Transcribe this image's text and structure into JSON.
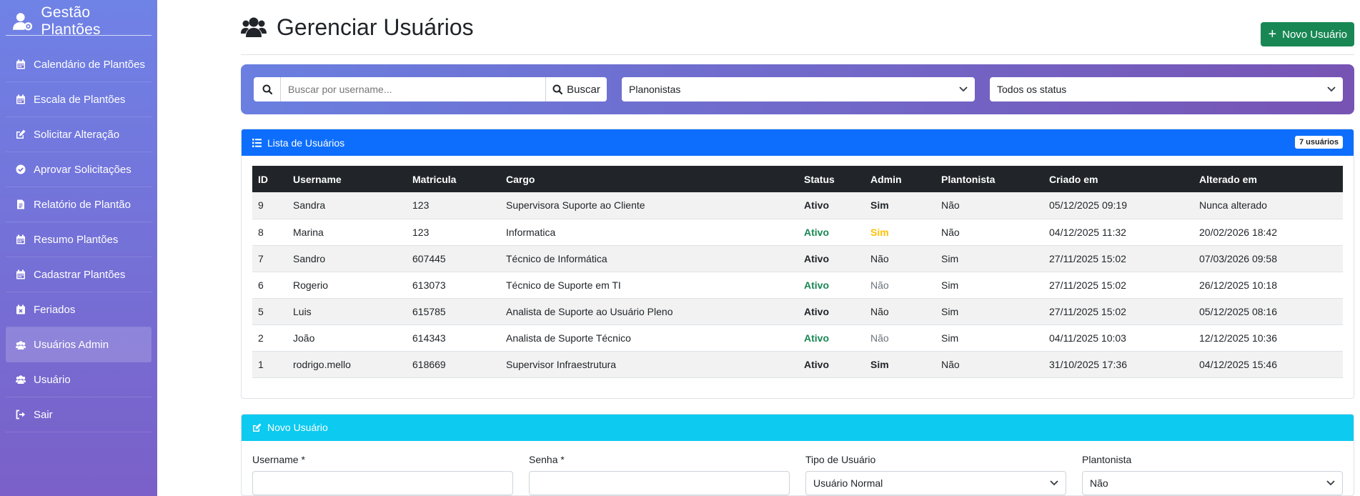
{
  "app": {
    "title": "Gestão Plantões"
  },
  "sidebar": {
    "items": [
      {
        "label": "Calendário de Plantões",
        "icon": "calendar-icon"
      },
      {
        "label": "Escala de Plantões",
        "icon": "calendar-icon"
      },
      {
        "label": "Solicitar Alteração",
        "icon": "edit-icon"
      },
      {
        "label": "Aprovar Solicitações",
        "icon": "check-circle-icon"
      },
      {
        "label": "Relatório de Plantão",
        "icon": "file-icon"
      },
      {
        "label": "Resumo Plantões",
        "icon": "calendar-icon"
      },
      {
        "label": "Cadastrar Plantões",
        "icon": "calendar-icon"
      },
      {
        "label": "Feriados",
        "icon": "calendar-x-icon"
      },
      {
        "label": "Usuários Admin",
        "icon": "users-icon",
        "active": true
      },
      {
        "label": "Usuário",
        "icon": "users-icon"
      },
      {
        "label": "Sair",
        "icon": "sign-out-icon"
      }
    ]
  },
  "header": {
    "title": "Gerenciar Usuários",
    "new_button": "Novo Usuário"
  },
  "filters": {
    "search_placeholder": "Buscar por username...",
    "search_button": "Buscar",
    "type_select": "Planonistas",
    "status_select": "Todos os status"
  },
  "list": {
    "title": "Lista de Usuários",
    "badge": "7 usuários",
    "columns": [
      "ID",
      "Username",
      "Matricula",
      "Cargo",
      "Status",
      "Admin",
      "Plantonista",
      "Criado em",
      "Alterado em"
    ],
    "rows": [
      {
        "id": "9",
        "username": "Sandra",
        "matricula": "123",
        "cargo": "Supervisora Suporte ao Cliente",
        "status": "Ativo",
        "status_style": "bold",
        "admin": "Sim",
        "admin_style": "bold",
        "plantonista": "Não",
        "criado": "05/12/2025 09:19",
        "alterado": "Nunca alterado"
      },
      {
        "id": "8",
        "username": "Marina",
        "matricula": "123",
        "cargo": "Informatica",
        "status": "Ativo",
        "status_style": "green",
        "admin": "Sim",
        "admin_style": "yellow",
        "plantonista": "Não",
        "criado": "04/12/2025 11:32",
        "alterado": "20/02/2026 18:42"
      },
      {
        "id": "7",
        "username": "Sandro",
        "matricula": "607445",
        "cargo": "Técnico de Informática",
        "status": "Ativo",
        "status_style": "bold",
        "admin": "Não",
        "admin_style": "",
        "plantonista": "Sim",
        "criado": "27/11/2025 15:02",
        "alterado": "07/03/2026 09:58"
      },
      {
        "id": "6",
        "username": "Rogerio",
        "matricula": "613073",
        "cargo": "Técnico de Suporte em TI",
        "status": "Ativo",
        "status_style": "green",
        "admin": "Não",
        "admin_style": "muted",
        "plantonista": "Sim",
        "criado": "27/11/2025 15:02",
        "alterado": "26/12/2025 10:18"
      },
      {
        "id": "5",
        "username": "Luis",
        "matricula": "615785",
        "cargo": "Analista de Suporte ao Usuário Pleno",
        "status": "Ativo",
        "status_style": "bold",
        "admin": "Não",
        "admin_style": "",
        "plantonista": "Sim",
        "criado": "27/11/2025 15:02",
        "alterado": "05/12/2025 08:16"
      },
      {
        "id": "2",
        "username": "João",
        "matricula": "614343",
        "cargo": "Analista de Suporte Técnico",
        "status": "Ativo",
        "status_style": "green",
        "admin": "Não",
        "admin_style": "muted",
        "plantonista": "Sim",
        "criado": "04/11/2025 10:03",
        "alterado": "12/12/2025 10:36"
      },
      {
        "id": "1",
        "username": "rodrigo.mello",
        "matricula": "618669",
        "cargo": "Supervisor Infraestrutura",
        "status": "Ativo",
        "status_style": "bold",
        "admin": "Sim",
        "admin_style": "bold",
        "plantonista": "Não",
        "criado": "31/10/2025 17:36",
        "alterado": "04/12/2025 15:46"
      }
    ]
  },
  "form": {
    "title": "Novo Usuário",
    "username_label": "Username *",
    "senha_label": "Senha *",
    "tipo_label": "Tipo de Usuário",
    "tipo_value": "Usuário Normal",
    "plantonista_label": "Plantonista",
    "plantonista_value": "Não"
  },
  "colors": {
    "primary": "#0d6efd",
    "info": "#0dcaf0",
    "success": "#198754",
    "warning": "#ffc107",
    "dark": "#212529"
  }
}
